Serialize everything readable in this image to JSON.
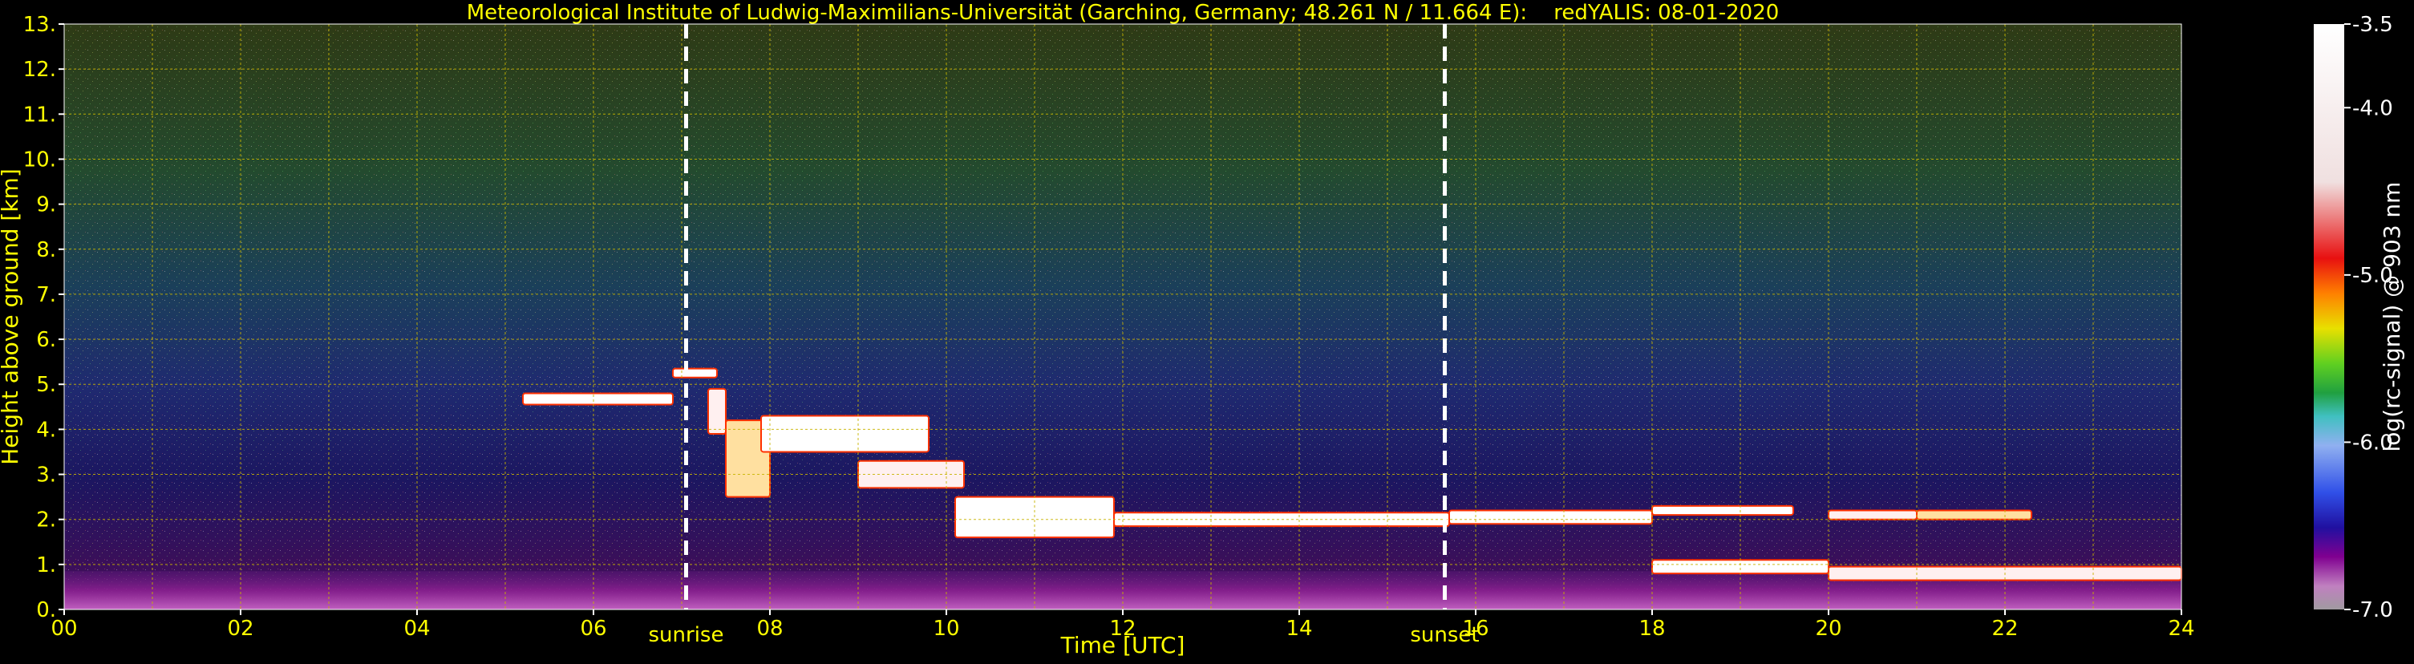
{
  "chart_data": {
    "type": "heatmap",
    "title": "Meteorological Institute of Ludwig-Maximilians-Universität (Garching, Germany; 48.261 N / 11.664 E):    redYALIS: 08-01-2020",
    "xlabel": "Time [UTC]",
    "ylabel": "Height above ground [km]",
    "colorbar_label": "log(rc-signal) @ 903 nm",
    "xlim": [
      0,
      24
    ],
    "ylim": [
      0,
      13
    ],
    "x_tick_labels": [
      "00",
      "02",
      "04",
      "06",
      "08",
      "10",
      "12",
      "14",
      "16",
      "18",
      "20",
      "22",
      "24"
    ],
    "y_tick_labels": [
      "0.",
      "1.",
      "2.",
      "3.",
      "4.",
      "5.",
      "6.",
      "7.",
      "8.",
      "9.",
      "10.",
      "11.",
      "12.",
      "13."
    ],
    "colorbar_range": [
      -7.0,
      -3.5
    ],
    "colorbar_ticks": [
      {
        "value": -3.5,
        "label": "-3.5"
      },
      {
        "value": -4.0,
        "label": "-4.0"
      },
      {
        "value": -5.0,
        "label": "-5.0"
      },
      {
        "value": -6.0,
        "label": "-6.0"
      },
      {
        "value": -7.0,
        "label": "-7.0"
      }
    ],
    "events": [
      {
        "label": "sunrise",
        "time": 7.05
      },
      {
        "label": "sunset",
        "time": 15.65
      }
    ],
    "grid": true,
    "layers": [
      {
        "t": [
          5.2,
          6.9
        ],
        "h": [
          4.55,
          4.8
        ],
        "v": -3.9
      },
      {
        "t": [
          6.9,
          7.4
        ],
        "h": [
          5.15,
          5.35
        ],
        "v": -3.9
      },
      {
        "t": [
          7.3,
          7.5
        ],
        "h": [
          3.9,
          4.9
        ],
        "v": -4.2
      },
      {
        "t": [
          7.5,
          8.0
        ],
        "h": [
          2.5,
          4.2
        ],
        "v": -4.6
      },
      {
        "t": [
          7.9,
          9.8
        ],
        "h": [
          3.5,
          4.3
        ],
        "v": -4.0
      },
      {
        "t": [
          9.0,
          10.2
        ],
        "h": [
          2.7,
          3.3
        ],
        "v": -4.4
      },
      {
        "t": [
          10.1,
          11.9
        ],
        "h": [
          1.6,
          2.5
        ],
        "v": -4.1
      },
      {
        "t": [
          11.9,
          15.7
        ],
        "h": [
          1.85,
          2.15
        ],
        "v": -4.0
      },
      {
        "t": [
          15.7,
          18.0
        ],
        "h": [
          1.9,
          2.2
        ],
        "v": -3.9
      },
      {
        "t": [
          18.0,
          19.6
        ],
        "h": [
          2.1,
          2.3
        ],
        "v": -3.9
      },
      {
        "t": [
          20.0,
          21.0
        ],
        "h": [
          2.0,
          2.2
        ],
        "v": -4.2
      },
      {
        "t": [
          21.0,
          22.3
        ],
        "h": [
          2.0,
          2.2
        ],
        "v": -4.5
      },
      {
        "t": [
          18.0,
          20.0
        ],
        "h": [
          0.8,
          1.1
        ],
        "v": -4.0
      },
      {
        "t": [
          20.0,
          24.0
        ],
        "h": [
          0.65,
          0.95
        ],
        "v": -4.3
      }
    ],
    "surface_layer": {
      "h": [
        0.0,
        0.85
      ],
      "v": -6.5
    }
  },
  "colors": {
    "text": "#ffff00",
    "background": "#000000",
    "grid": "#c8b400",
    "event_line": "#ffffff",
    "cloud": "#ffffff",
    "cloud_edge": "#ff3000"
  }
}
